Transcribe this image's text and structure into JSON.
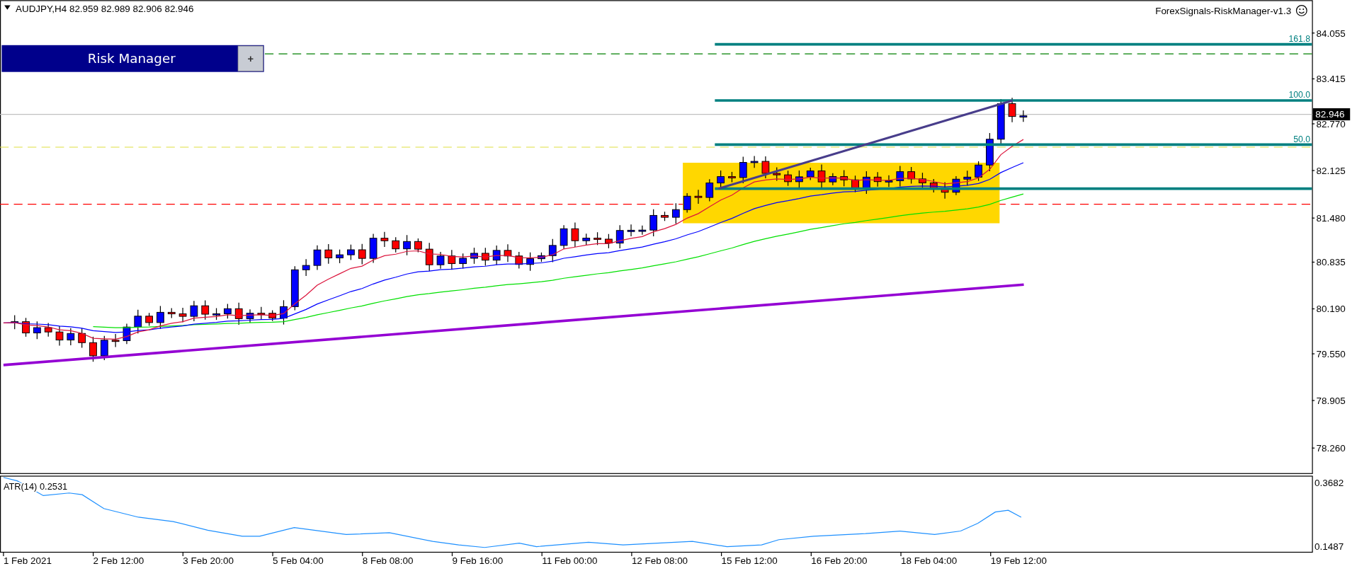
{
  "chart_header": {
    "symbol_info": "AUDJPY,H4  82.959 82.989 82.906 82.946",
    "expert_name": "ForexSignals-RiskManager-v1.3"
  },
  "risk_manager": {
    "title": "Risk Manager",
    "toggle": "+"
  },
  "fibonacci_levels": [
    "161.8",
    "100.0",
    "50.0"
  ],
  "price_axis": [
    "84.055",
    "83.415",
    "82.770",
    "82.125",
    "81.480",
    "80.835",
    "80.190",
    "79.550",
    "78.905",
    "78.260"
  ],
  "current_price": "82.946",
  "atr_pane": {
    "label": "ATR(14) 0.2531",
    "axis": [
      "0.3682",
      "0.1487"
    ]
  },
  "time_axis": [
    "1 Feb 2021",
    "2 Feb 12:00",
    "3 Feb 20:00",
    "5 Feb 04:00",
    "8 Feb 08:00",
    "9 Feb 16:00",
    "11 Feb 00:00",
    "12 Feb 08:00",
    "15 Feb 12:00",
    "16 Feb 20:00",
    "18 Feb 04:00",
    "19 Feb 12:00"
  ]
}
